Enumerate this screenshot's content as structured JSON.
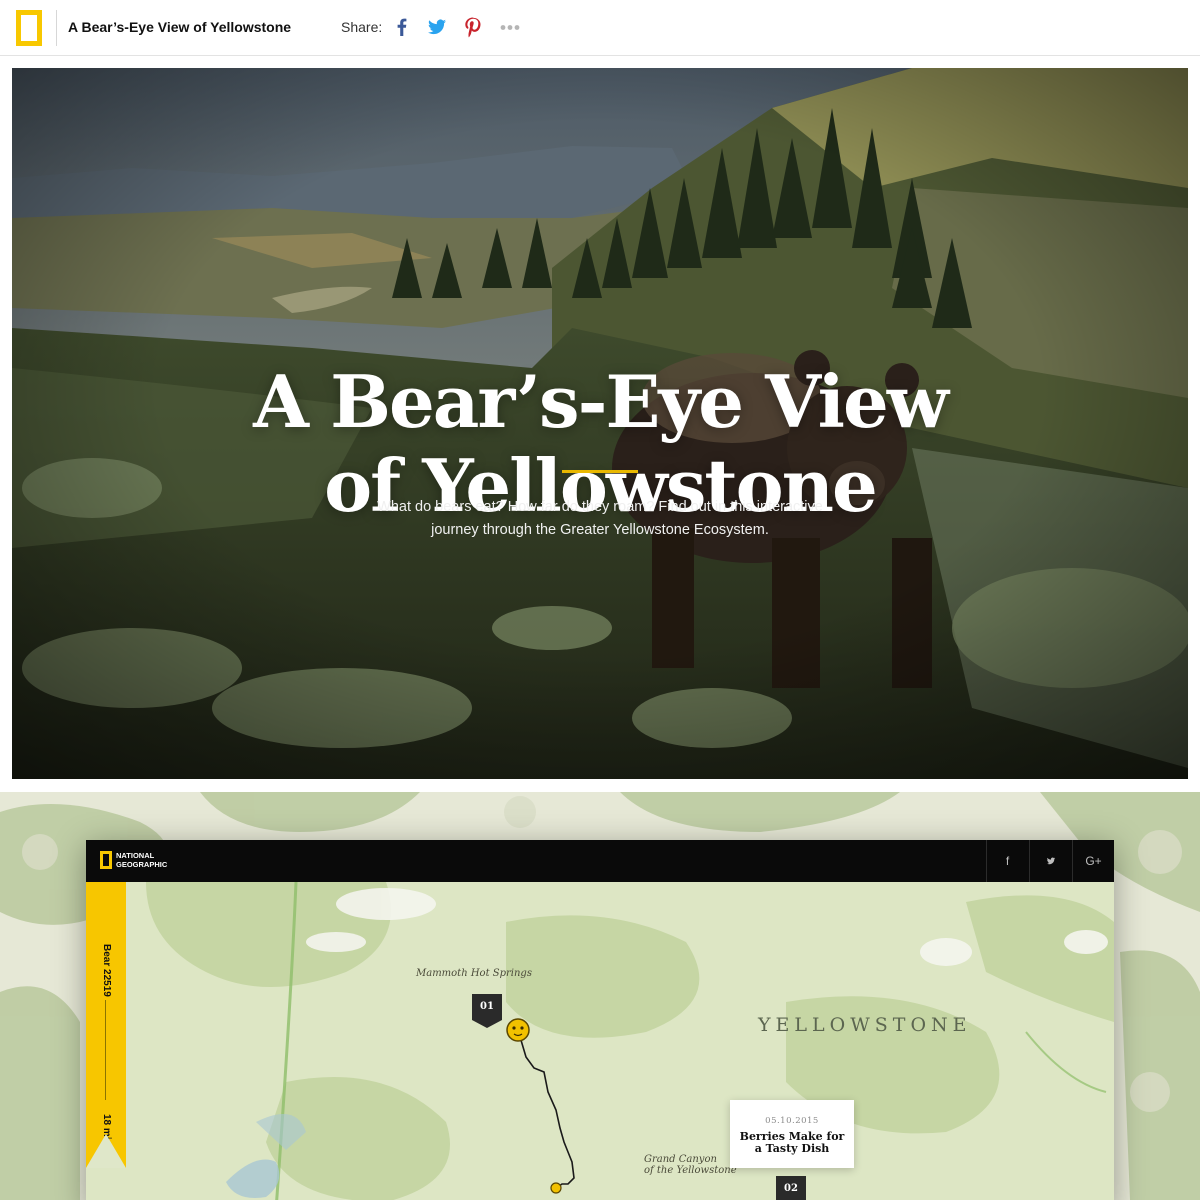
{
  "header": {
    "title": "A Bear’s-Eye View of Yellowstone",
    "share_label": "Share:",
    "share_icons": [
      "facebook-icon",
      "twitter-icon",
      "pinterest-icon",
      "more-icon"
    ],
    "brand_color": "#f8c800"
  },
  "hero": {
    "title_line1": "A Bear’s-Eye View",
    "title_line2": "of Yellowstone",
    "subtitle_line1": "What do bears eat? How far do they roam? Find out in this interactive",
    "subtitle_line2": "journey through the Greater Yellowstone Ecosystem.",
    "rule_color": "#e9b800"
  },
  "map_preview": {
    "brand_line1": "NATIONAL",
    "brand_line2": "GEOGRAPHIC",
    "social": [
      "f",
      "t",
      "G+"
    ],
    "bear_id": "Bear 22519",
    "distance": "18 mi",
    "labels": {
      "mammoth": "Mammoth Hot Springs",
      "park": "YELLOWSTONE",
      "canyon_line1": "Grand Canyon",
      "canyon_line2": "of the Yellowstone"
    },
    "markers": [
      "01",
      "02"
    ],
    "card": {
      "date": "05.10.2015",
      "title_line1": "Berries Make for",
      "title_line2": "a Tasty Dish"
    },
    "accent_color": "#f7c600"
  }
}
